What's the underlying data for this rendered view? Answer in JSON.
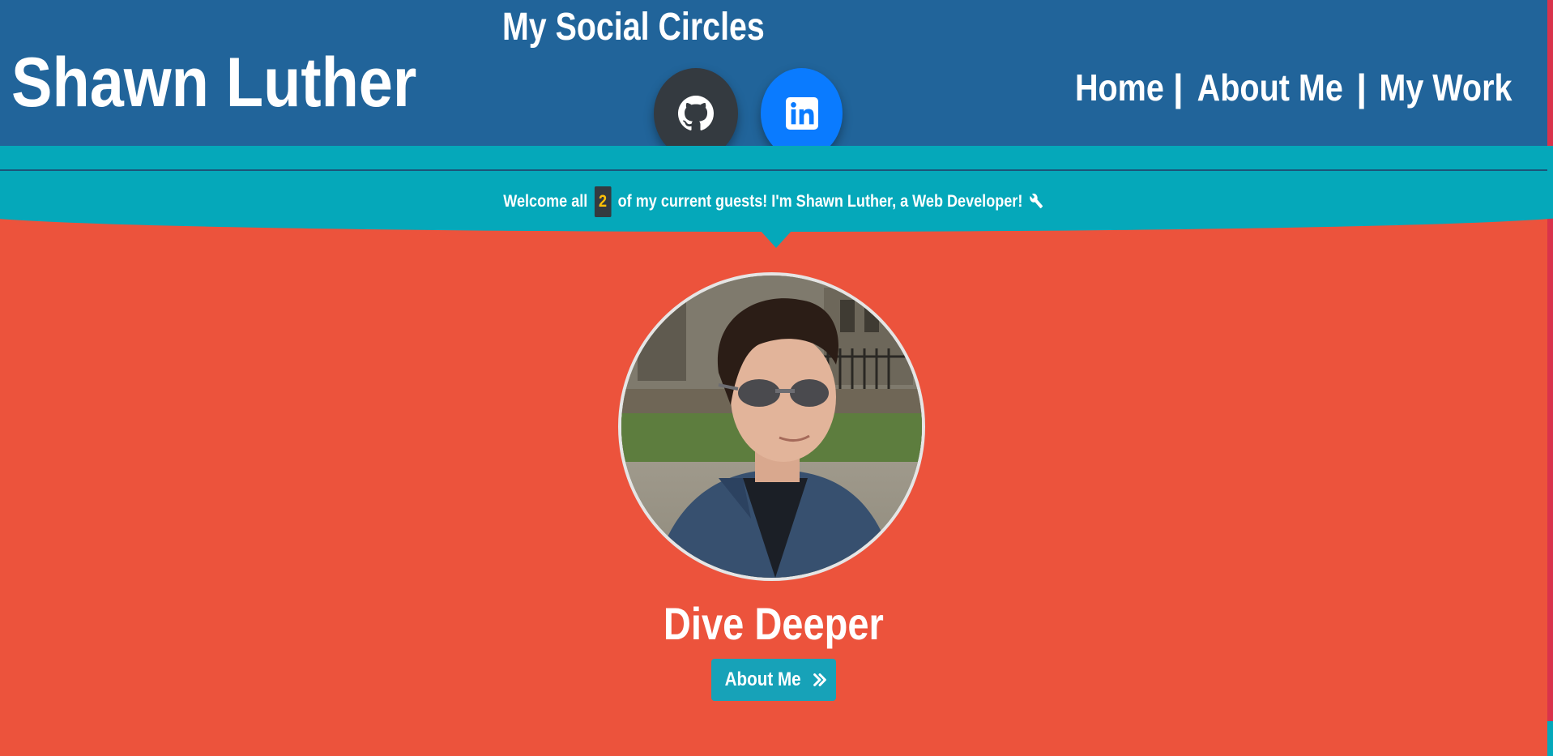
{
  "header": {
    "site_name": "Shawn Luther",
    "social_title": "My Social Circles",
    "social_links": [
      {
        "name": "github",
        "icon": "github-icon"
      },
      {
        "name": "linkedin",
        "icon": "linkedin-icon"
      }
    ],
    "nav": {
      "home": "Home",
      "about": "About Me",
      "work": "My Work",
      "separator": "|"
    }
  },
  "banner": {
    "welcome_prefix": "Welcome all",
    "guest_count": "2",
    "welcome_suffix": "of my current guests! I'm Shawn Luther, a Web Developer!",
    "icon": "wrench-icon"
  },
  "main": {
    "profile_image": "profile-photo",
    "heading": "Dive Deeper",
    "cta_label": "About Me",
    "cta_icon": "double-chevron-right-icon"
  },
  "colors": {
    "header_bg": "#21649A",
    "banner_bg": "#05A8BA",
    "page_bg": "#EC533C",
    "github_bg": "#343A40",
    "linkedin_bg": "#0A7BFF",
    "count_text": "#FFC107",
    "button_bg": "#17A2B8"
  }
}
